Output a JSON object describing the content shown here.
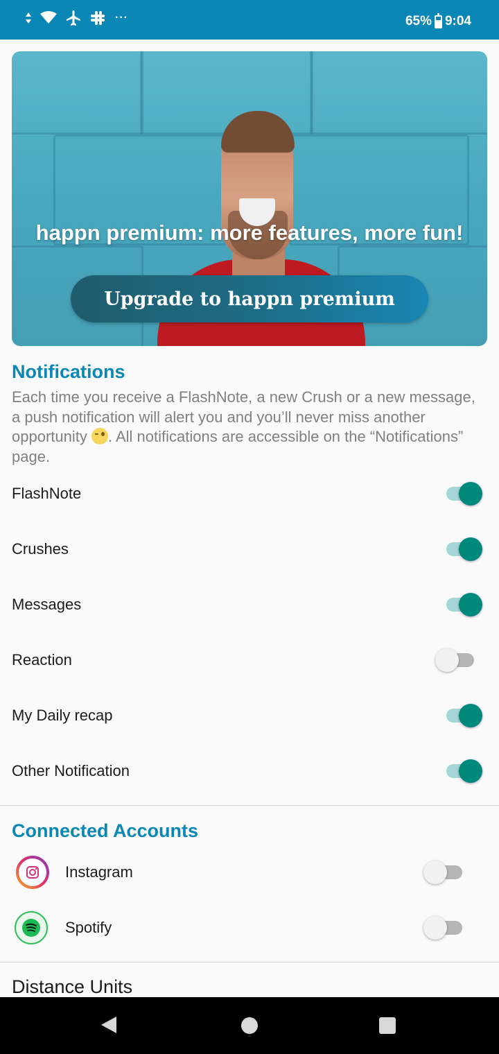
{
  "status_bar": {
    "battery": "65%",
    "time": "9:04",
    "icons": [
      "signal-icon",
      "wifi-icon",
      "airplane-icon",
      "slack-icon",
      "more-notifications-icon",
      "battery-icon"
    ],
    "more_indicator": "···"
  },
  "banner": {
    "title": "happn premium: more features, more fun!",
    "button_label": "Upgrade to happn premium"
  },
  "notifications": {
    "title": "Notifications",
    "description_before": "Each time you receive a FlashNote, a new Crush or a new message, a push notification will alert you and you’ll never miss another opportunity ",
    "description_after": ". All notifications are accessible on the “Notifications” page.",
    "items": [
      {
        "label": "FlashNote",
        "enabled": true
      },
      {
        "label": "Crushes",
        "enabled": true
      },
      {
        "label": "Messages",
        "enabled": true
      },
      {
        "label": "Reaction",
        "enabled": false
      },
      {
        "label": "My Daily recap",
        "enabled": true
      },
      {
        "label": "Other Notification",
        "enabled": true
      }
    ]
  },
  "connected_accounts": {
    "title": "Connected Accounts",
    "items": [
      {
        "label": "Instagram",
        "icon": "instagram-icon",
        "enabled": false
      },
      {
        "label": "Spotify",
        "icon": "spotify-icon",
        "enabled": false
      }
    ]
  },
  "distance_units": {
    "title": "Distance Units"
  },
  "colors": {
    "accent": "#0a87b4",
    "toggle_on": "#00887a",
    "toggle_on_track": "#a6d6d3"
  }
}
